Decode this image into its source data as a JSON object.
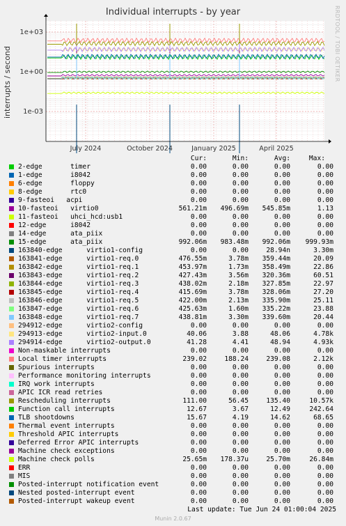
{
  "chart_data": {
    "type": "line",
    "title": "Individual interrupts - by year",
    "ylabel": "interrupts / second",
    "yscale": "log",
    "ylim": [
      0.0001,
      30
    ],
    "yticks": [
      "1e+03",
      "1e+00",
      "1e-03"
    ],
    "xticks": [
      "July 2024",
      "October 2024",
      "January 2025",
      "April 2025"
    ],
    "grid": true,
    "side_label": "RRDTOOL / TOBI OETIKER",
    "columns": [
      "Cur:",
      "Min:",
      "Avg:",
      "Max:"
    ],
    "series": [
      {
        "name": "2-edge       timer",
        "color": "#00cc00",
        "cur": "0.00",
        "min": "0.00",
        "avg": "0.00",
        "max": "0.00"
      },
      {
        "name": "1-edge       i8042",
        "color": "#0066b3",
        "cur": "0.00",
        "min": "0.00",
        "avg": "0.00",
        "max": "0.00"
      },
      {
        "name": "6-edge       floppy",
        "color": "#ff8000",
        "cur": "0.00",
        "min": "0.00",
        "avg": "0.00",
        "max": "0.00"
      },
      {
        "name": "8-edge       rtc0",
        "color": "#ffcc00",
        "cur": "0.00",
        "min": "0.00",
        "avg": "0.00",
        "max": "0.00"
      },
      {
        "name": "9-fasteoi   acpi",
        "color": "#330099",
        "cur": "0.00",
        "min": "0.00",
        "avg": "0.00",
        "max": "0.00"
      },
      {
        "name": "10-fasteoi   virtio0",
        "color": "#990099",
        "cur": "561.21m",
        "min": "496.69m",
        "avg": "545.85m",
        "max": "1.13"
      },
      {
        "name": "11-fasteoi   uhci_hcd:usb1",
        "color": "#ccff00",
        "cur": "0.00",
        "min": "0.00",
        "avg": "0.00",
        "max": "0.00"
      },
      {
        "name": "12-edge      i8042",
        "color": "#ff0000",
        "cur": "0.00",
        "min": "0.00",
        "avg": "0.00",
        "max": "0.00"
      },
      {
        "name": "14-edge      ata_piix",
        "color": "#808080",
        "cur": "0.00",
        "min": "0.00",
        "avg": "0.00",
        "max": "0.00"
      },
      {
        "name": "15-edge      ata_piix",
        "color": "#008f00",
        "cur": "992.06m",
        "min": "983.48m",
        "avg": "992.06m",
        "max": "999.93m"
      },
      {
        "name": "163840-edge      virtio1-config",
        "color": "#00487d",
        "cur": "0.00",
        "min": "0.00",
        "avg": "28.94n",
        "max": "3.30m"
      },
      {
        "name": "163841-edge      virtio1-req.0",
        "color": "#b35a00",
        "cur": "476.55m",
        "min": "3.78m",
        "avg": "359.44m",
        "max": "20.09"
      },
      {
        "name": "163842-edge      virtio1-req.1",
        "color": "#b38f00",
        "cur": "453.97m",
        "min": "1.73m",
        "avg": "358.49m",
        "max": "22.86"
      },
      {
        "name": "163843-edge      virtio1-req.2",
        "color": "#6b006b",
        "cur": "427.43m",
        "min": "3.56m",
        "avg": "320.36m",
        "max": "60.51"
      },
      {
        "name": "163844-edge      virtio1-req.3",
        "color": "#8fb300",
        "cur": "438.02m",
        "min": "2.18m",
        "avg": "327.85m",
        "max": "22.97"
      },
      {
        "name": "163845-edge      virtio1-req.4",
        "color": "#b30000",
        "cur": "415.69m",
        "min": "3.78m",
        "avg": "328.06m",
        "max": "27.20"
      },
      {
        "name": "163846-edge      virtio1-req.5",
        "color": "#bebebe",
        "cur": "422.00m",
        "min": "2.13m",
        "avg": "335.90m",
        "max": "25.11"
      },
      {
        "name": "163847-edge      virtio1-req.6",
        "color": "#80ff80",
        "cur": "425.63m",
        "min": "1.60m",
        "avg": "335.22m",
        "max": "23.88"
      },
      {
        "name": "163848-edge      virtio1-req.7",
        "color": "#80c9ff",
        "cur": "438.81m",
        "min": "3.30m",
        "avg": "339.60m",
        "max": "20.44"
      },
      {
        "name": "294912-edge      virtio2-config",
        "color": "#ffc080",
        "cur": "0.00",
        "min": "0.00",
        "avg": "0.00",
        "max": "0.00"
      },
      {
        "name": "294913-edge      virtio2-input.0",
        "color": "#ffe680",
        "cur": "40.06",
        "min": "3.88",
        "avg": "48.06",
        "max": "4.78k"
      },
      {
        "name": "294914-edge      virtio2-output.0",
        "color": "#aa80ff",
        "cur": "41.28",
        "min": "4.41",
        "avg": "48.94",
        "max": "4.93k"
      },
      {
        "name": "Non-maskable interrupts",
        "color": "#ee00cc",
        "cur": "0.00",
        "min": "0.00",
        "avg": "0.00",
        "max": "0.00"
      },
      {
        "name": "Local timer interrupts",
        "color": "#ff8080",
        "cur": "239.02",
        "min": "188.24",
        "avg": "239.08",
        "max": "2.12k"
      },
      {
        "name": "Spurious interrupts",
        "color": "#666600",
        "cur": "0.00",
        "min": "0.00",
        "avg": "0.00",
        "max": "0.00"
      },
      {
        "name": "Performance monitoring interrupts",
        "color": "#ffbfff",
        "cur": "0.00",
        "min": "0.00",
        "avg": "0.00",
        "max": "0.00"
      },
      {
        "name": "IRQ work interrupts",
        "color": "#00ffcc",
        "cur": "0.00",
        "min": "0.00",
        "avg": "0.00",
        "max": "0.00"
      },
      {
        "name": "APIC ICR read retries",
        "color": "#cc6699",
        "cur": "0.00",
        "min": "0.00",
        "avg": "0.00",
        "max": "0.00"
      },
      {
        "name": "Rescheduling interrupts",
        "color": "#999900",
        "cur": "111.00",
        "min": "56.45",
        "avg": "135.40",
        "max": "10.57k"
      },
      {
        "name": "Function call interrupts",
        "color": "#00cc00",
        "cur": "12.67",
        "min": "3.67",
        "avg": "12.49",
        "max": "242.64"
      },
      {
        "name": "TLB shootdowns",
        "color": "#0066b3",
        "cur": "15.67",
        "min": "4.19",
        "avg": "14.62",
        "max": "68.65"
      },
      {
        "name": "Thermal event interrupts",
        "color": "#ff8000",
        "cur": "0.00",
        "min": "0.00",
        "avg": "0.00",
        "max": "0.00"
      },
      {
        "name": "Threshold APIC interrupts",
        "color": "#ffcc00",
        "cur": "0.00",
        "min": "0.00",
        "avg": "0.00",
        "max": "0.00"
      },
      {
        "name": "Deferred Error APIC interrupts",
        "color": "#330099",
        "cur": "0.00",
        "min": "0.00",
        "avg": "0.00",
        "max": "0.00"
      },
      {
        "name": "Machine check exceptions",
        "color": "#990099",
        "cur": "0.00",
        "min": "0.00",
        "avg": "0.00",
        "max": "0.00"
      },
      {
        "name": "Machine check polls",
        "color": "#ccff00",
        "cur": "25.65m",
        "min": "178.37u",
        "avg": "25.70m",
        "max": "26.84m"
      },
      {
        "name": "ERR",
        "color": "#ff0000",
        "cur": "0.00",
        "min": "0.00",
        "avg": "0.00",
        "max": "0.00"
      },
      {
        "name": "MIS",
        "color": "#808080",
        "cur": "0.00",
        "min": "0.00",
        "avg": "0.00",
        "max": "0.00"
      },
      {
        "name": "Posted-interrupt notification event",
        "color": "#008f00",
        "cur": "0.00",
        "min": "0.00",
        "avg": "0.00",
        "max": "0.00"
      },
      {
        "name": "Nested posted-interrupt event",
        "color": "#00487d",
        "cur": "0.00",
        "min": "0.00",
        "avg": "0.00",
        "max": "0.00"
      },
      {
        "name": "Posted-interrupt wakeup event",
        "color": "#b35a00",
        "cur": "0.00",
        "min": "0.00",
        "avg": "0.00",
        "max": "0.00"
      }
    ]
  },
  "footer": {
    "last_update": "Last update: Tue Jun 24 01:00:04 2025",
    "munin": "Munin 2.0.67"
  }
}
